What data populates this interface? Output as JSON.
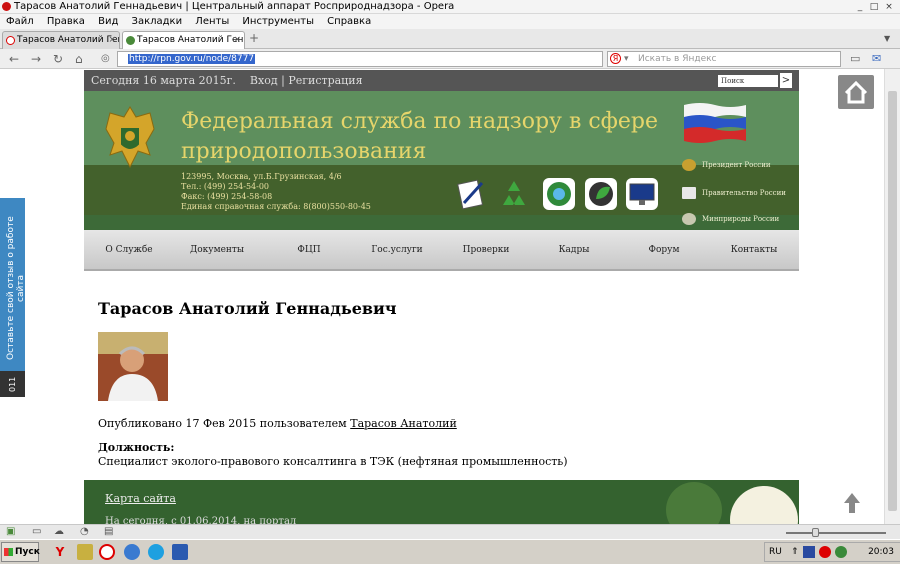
{
  "window": {
    "title": "Тарасов Анатолий Геннадьевич | Центральный аппарат Росприроднадзора - Opera",
    "minimize": "_",
    "maximize": "□",
    "close": "×"
  },
  "menu": [
    "Файл",
    "Правка",
    "Вид",
    "Закладки",
    "Ленты",
    "Инструменты",
    "Справка"
  ],
  "tabs": [
    {
      "label": "Тарасов Анатолий Генн...",
      "active": false
    },
    {
      "label": "Тарасов Анатолий Генн...",
      "active": true
    }
  ],
  "tab_close": "×",
  "tab_add": "+",
  "address": {
    "url": "http://rpn.gov.ru/node/8777",
    "search_placeholder": "Искать в Яндекс",
    "yandex_letter": "Я"
  },
  "page": {
    "date_text": "Сегодня 16 марта 2015г.",
    "login": "Вход",
    "sep": "|",
    "register": "Регистрация",
    "search_placeholder": "Поиск",
    "search_go": ">",
    "org_name": "Федеральная служба по надзору в сфере природопользования",
    "contacts": [
      "123995, Москва, ул.Б.Грузинская, 4/6",
      "Тел.: (499) 254-54-00",
      "Факс: (499) 254-58-08",
      "Единая справочная служба: 8(800)550-80-45"
    ],
    "right_links": [
      "Президент России",
      "Правительство России",
      "Минприроды России"
    ],
    "nav": [
      "О Службе",
      "Документы",
      "ФЦП",
      "Гос.услуги",
      "Проверки",
      "Кадры",
      "Форум",
      "Контакты"
    ],
    "person_name": "Тарасов Анатолий Геннадьевич",
    "published_prefix": "Опубликовано 17 Фев 2015 пользователем",
    "published_user": "Тарасов Анатолий",
    "position_label": "Должность:",
    "position_value": "Специалист эколого-правового консалтинга в ТЭК (нефтяная промышленность)",
    "footer_sitemap": "Карта сайта",
    "footer_visits": "На сегодня, с 01.06.2014, на портал",
    "feedback_text": "Оставьте свой отзыв о работе сайта",
    "feedback_count": "011"
  },
  "taskbar": {
    "start": "Пуск",
    "lang": "RU",
    "clock": "20:03"
  },
  "colors": {
    "header_green": "#5e8f5d",
    "title_gold": "#e6d56b",
    "feedback_blue": "#3e88c2",
    "footer_green": "#34622f"
  }
}
